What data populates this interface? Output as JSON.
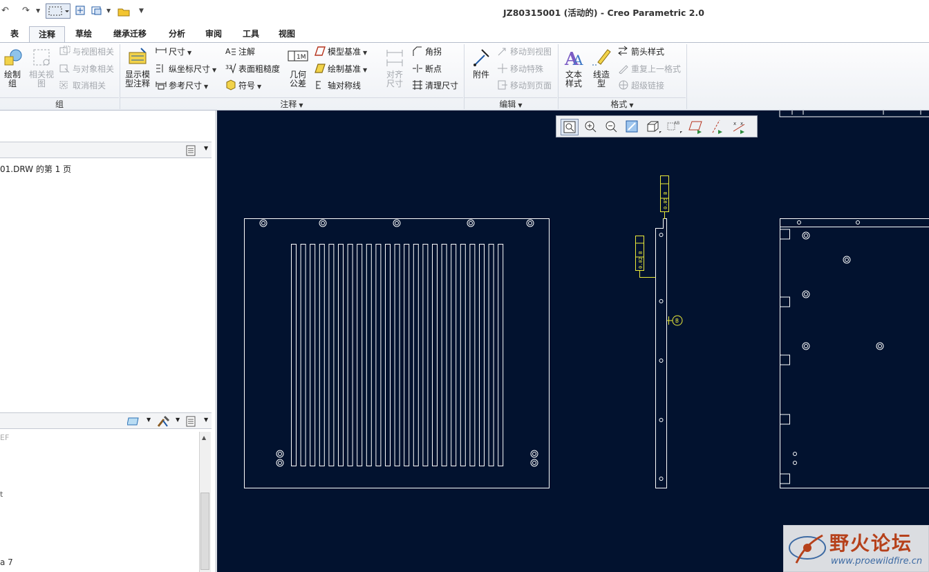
{
  "window": {
    "title": "JZ80315001 (活动的) - Creo Parametric 2.0"
  },
  "quick_access": {
    "more": "▼"
  },
  "tabs": [
    {
      "label": "表"
    },
    {
      "label": "注释"
    },
    {
      "label": "草绘"
    },
    {
      "label": "继承迁移"
    },
    {
      "label": "分析"
    },
    {
      "label": "审阅"
    },
    {
      "label": "工具"
    },
    {
      "label": "视图"
    }
  ],
  "ribbon": {
    "group": {
      "label": "组",
      "draw_group": "绘制\n组",
      "related_view": "相关视\n图",
      "relate_view": "与视图相关",
      "relate_object": "与对象相关",
      "unrelate": "取消相关"
    },
    "annotate": {
      "label": "注释",
      "show_model": "显示模\n型注释",
      "dimension": "尺寸",
      "ordinate": "纵坐标尺寸",
      "reference": "参考尺寸",
      "note": "注解",
      "surface_finish": "表面粗糙度",
      "symbol": "符号",
      "gtol": "几何\n公差",
      "model_datum": "模型基准",
      "draft_datum": "绘制基准",
      "axis_sym": "轴对称线",
      "align_dim": "对齐\n尺寸",
      "jog": "角拐",
      "break": "断点",
      "cleanup": "清理尺寸"
    },
    "edit": {
      "label": "编辑",
      "attach": "附件",
      "move_view": "移动到视图",
      "move_special": "移动特殊",
      "move_page": "移动到页面"
    },
    "format": {
      "label": "格式",
      "text_style": "文本\n样式",
      "line_style": "线造\n型",
      "arrow_style": "箭头样式",
      "repeat_format": "重复上一格式",
      "hyperlink": "超级链接"
    }
  },
  "left_panel": {
    "tree_item": "01.DRW 的第 1 页",
    "lower_item1": "EF",
    "lower_item2": "t",
    "lower_item3": "a 7"
  },
  "drawing": {
    "gtol_top": "0.05 B",
    "gtol_left": "0.02 B",
    "datum": "B"
  },
  "watermark": {
    "title": "野火论坛",
    "url": "www.proewildfire.cn"
  }
}
